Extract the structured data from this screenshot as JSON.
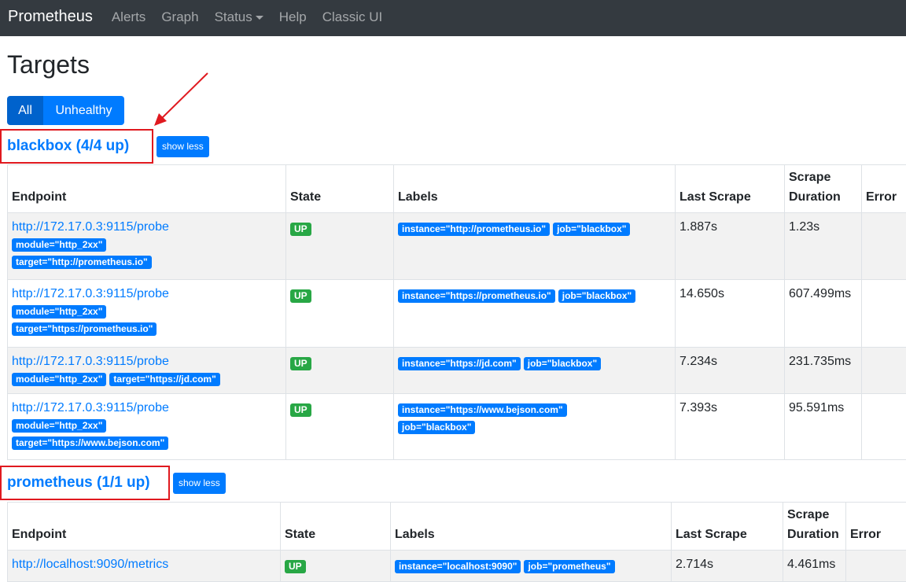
{
  "navbar": {
    "brand": "Prometheus",
    "links": [
      "Alerts",
      "Graph",
      "Status",
      "Help",
      "Classic UI"
    ]
  },
  "page": {
    "title": "Targets"
  },
  "filters": {
    "all_label": "All",
    "unhealthy_label": "Unhealthy"
  },
  "columns": {
    "endpoint": "Endpoint",
    "state": "State",
    "labels": "Labels",
    "last_scrape": "Last Scrape",
    "scrape_duration_1": "Scrape",
    "scrape_duration_2": "Duration",
    "error": "Error"
  },
  "pools": [
    {
      "title": "blackbox (4/4 up)",
      "toggle_label": "show less",
      "targets": [
        {
          "endpoint": "http://172.17.0.3:9115/probe",
          "params": [
            "module=\"http_2xx\"",
            "target=\"http://prometheus.io\""
          ],
          "state": "UP",
          "labels": [
            "instance=\"http://prometheus.io\"",
            "job=\"blackbox\""
          ],
          "last_scrape": "1.887s",
          "duration": "1.23s",
          "error": ""
        },
        {
          "endpoint": "http://172.17.0.3:9115/probe",
          "params": [
            "module=\"http_2xx\"",
            "target=\"https://prometheus.io\""
          ],
          "state": "UP",
          "labels": [
            "instance=\"https://prometheus.io\"",
            "job=\"blackbox\""
          ],
          "last_scrape": "14.650s",
          "duration": "607.499ms",
          "error": ""
        },
        {
          "endpoint": "http://172.17.0.3:9115/probe",
          "params": [
            "module=\"http_2xx\"",
            "target=\"https://jd.com\""
          ],
          "state": "UP",
          "labels": [
            "instance=\"https://jd.com\"",
            "job=\"blackbox\""
          ],
          "last_scrape": "7.234s",
          "duration": "231.735ms",
          "error": ""
        },
        {
          "endpoint": "http://172.17.0.3:9115/probe",
          "params": [
            "module=\"http_2xx\"",
            "target=\"https://www.bejson.com\""
          ],
          "state": "UP",
          "labels": [
            "instance=\"https://www.bejson.com\"",
            "job=\"blackbox\""
          ],
          "last_scrape": "7.393s",
          "duration": "95.591ms",
          "error": ""
        }
      ]
    },
    {
      "title": "prometheus (1/1 up)",
      "toggle_label": "show less",
      "targets": [
        {
          "endpoint": "http://localhost:9090/metrics",
          "params": [],
          "state": "UP",
          "labels": [
            "instance=\"localhost:9090\"",
            "job=\"prometheus\""
          ],
          "last_scrape": "2.714s",
          "duration": "4.461ms",
          "error": ""
        }
      ]
    }
  ],
  "colors": {
    "navbar_bg": "#343a40",
    "primary": "#007bff",
    "success": "#28a745",
    "annotation_red": "#e0191f"
  }
}
